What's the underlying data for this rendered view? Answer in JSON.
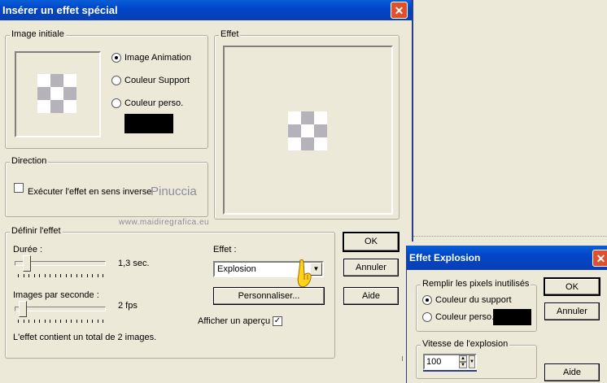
{
  "main_window": {
    "title": "Insérer un effet spécial",
    "close_glyph": "✕",
    "groups": {
      "image_initiale": "Image initiale",
      "effet_preview": "Effet",
      "direction": "Direction",
      "definir": "Définir l'effet"
    },
    "radios": [
      {
        "label": "Image Animation",
        "checked": true
      },
      {
        "label": "Couleur Support",
        "checked": false
      },
      {
        "label": "Couleur perso.",
        "checked": false
      }
    ],
    "custom_color": "#000000",
    "direction_checkbox": {
      "label": "Exécuter l'effet en sens inverse",
      "checked": false
    },
    "duree": {
      "label": "Durée :",
      "value_text": "1,3 sec.",
      "position": 0.1
    },
    "fps": {
      "label": "Images par seconde :",
      "value_text": "2 fps",
      "position": 0.05
    },
    "total_text": "L'effet contient un total de 2 images.",
    "effet_label": "Effet :",
    "effet_select": {
      "selected": "Explosion"
    },
    "personnaliser_label": "Personnaliser...",
    "apercu": {
      "label": "Afficher un aperçu",
      "checked": true
    },
    "buttons": {
      "ok": "OK",
      "cancel": "Annuler",
      "help": "Aide"
    }
  },
  "watermark": {
    "name": "Pinuccia",
    "site": "www.maidiregrafica.eu"
  },
  "explosion_window": {
    "title": "Effet Explosion",
    "close_glyph": "✕",
    "group_fill": "Remplir les pixels inutilisés",
    "radios": [
      {
        "label": "Couleur du support",
        "checked": true
      },
      {
        "label": "Couleur perso.",
        "checked": false
      }
    ],
    "custom_color": "#000000",
    "group_speed": "Vitesse de l'explosion",
    "speed_value": "100",
    "buttons": {
      "ok": "OK",
      "cancel": "Annuler",
      "help": "Aide"
    }
  },
  "colors": {
    "titlebar": "#0046c8",
    "dialog_bg": "#ece9d8",
    "close_button": "#e0502c"
  }
}
